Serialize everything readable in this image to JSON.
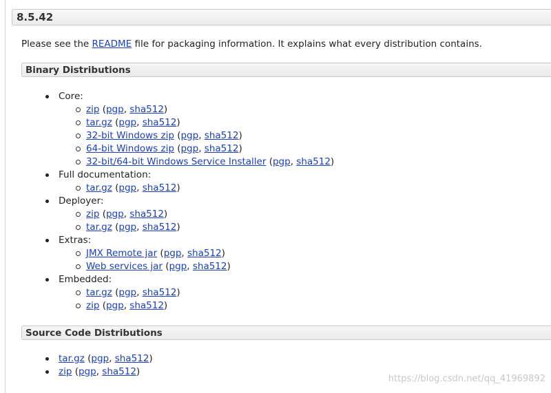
{
  "version": {
    "title": "8.5.42"
  },
  "intro": {
    "before": "Please see the ",
    "link": "README",
    "after": " file for packaging information. It explains what every distribution contains."
  },
  "binary": {
    "heading": "Binary Distributions",
    "groups": [
      {
        "label": "Core:",
        "items": [
          {
            "name": "zip",
            "sigs": [
              "pgp",
              "sha512"
            ]
          },
          {
            "name": "tar.gz",
            "sigs": [
              "pgp",
              "sha512"
            ]
          },
          {
            "name": "32-bit Windows zip",
            "sigs": [
              "pgp",
              "sha512"
            ]
          },
          {
            "name": "64-bit Windows zip",
            "sigs": [
              "pgp",
              "sha512"
            ]
          },
          {
            "name": "32-bit/64-bit Windows Service Installer",
            "sigs": [
              "pgp",
              "sha512"
            ]
          }
        ]
      },
      {
        "label": "Full documentation:",
        "items": [
          {
            "name": "tar.gz",
            "sigs": [
              "pgp",
              "sha512"
            ]
          }
        ]
      },
      {
        "label": "Deployer:",
        "items": [
          {
            "name": "zip",
            "sigs": [
              "pgp",
              "sha512"
            ]
          },
          {
            "name": "tar.gz",
            "sigs": [
              "pgp",
              "sha512"
            ]
          }
        ]
      },
      {
        "label": "Extras:",
        "items": [
          {
            "name": "JMX Remote jar",
            "sigs": [
              "pgp",
              "sha512"
            ]
          },
          {
            "name": "Web services jar",
            "sigs": [
              "pgp",
              "sha512"
            ]
          }
        ]
      },
      {
        "label": "Embedded:",
        "items": [
          {
            "name": "tar.gz",
            "sigs": [
              "pgp",
              "sha512"
            ]
          },
          {
            "name": "zip",
            "sigs": [
              "pgp",
              "sha512"
            ]
          }
        ]
      }
    ]
  },
  "source": {
    "heading": "Source Code Distributions",
    "items": [
      {
        "name": "tar.gz",
        "sigs": [
          "pgp",
          "sha512"
        ]
      },
      {
        "name": "zip",
        "sigs": [
          "pgp",
          "sha512"
        ]
      }
    ]
  },
  "watermark": "https://blog.csdn.net/qq_41969892",
  "colors": {
    "link": "#1a3fbf",
    "header_border": "#c9c9c9",
    "watermark": "#c8c8c8"
  }
}
